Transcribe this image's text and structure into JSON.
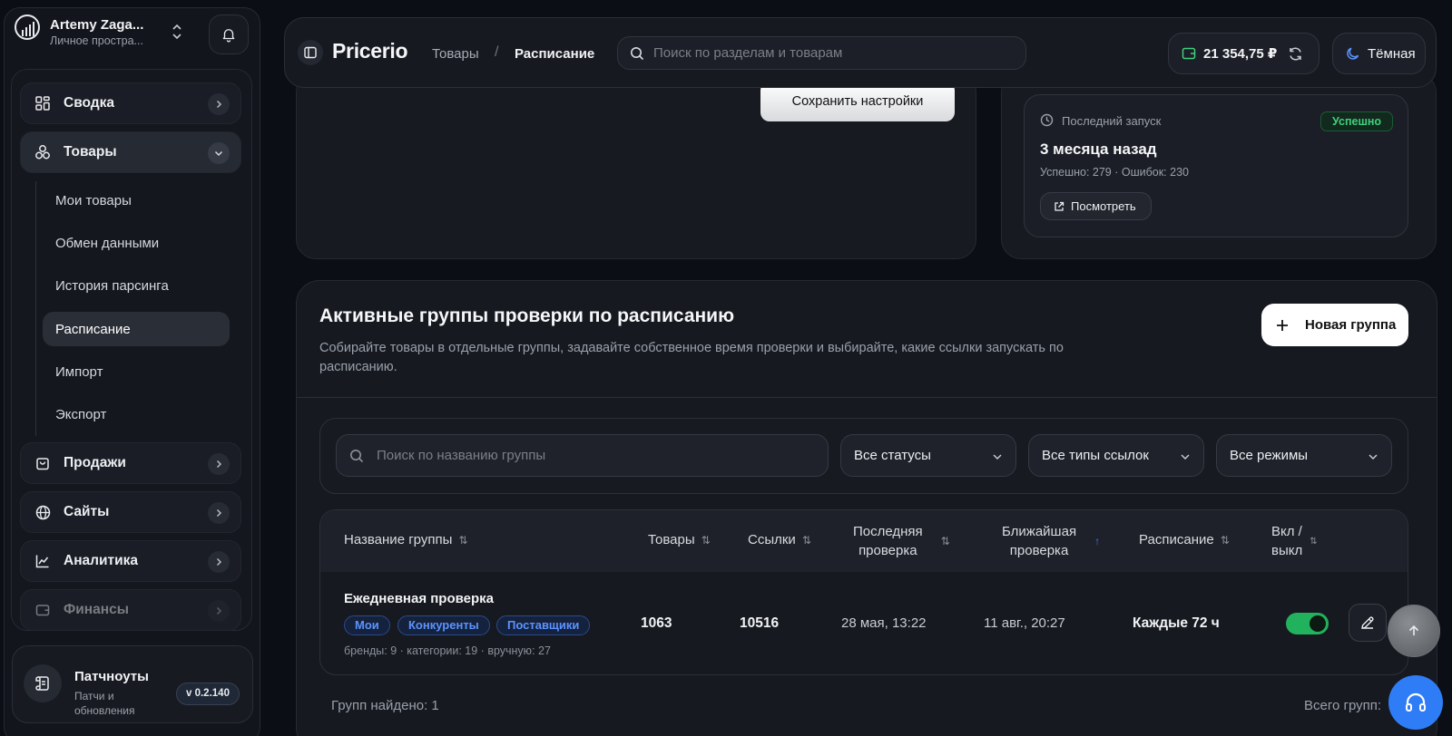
{
  "account": {
    "name": "Artemy Zaga...",
    "workspace": "Личное простра..."
  },
  "sidebar": {
    "items": [
      {
        "label": "Сводка"
      },
      {
        "label": "Товары"
      },
      {
        "label": "Продажи"
      },
      {
        "label": "Сайты"
      },
      {
        "label": "Аналитика"
      },
      {
        "label": "Финансы"
      }
    ],
    "products_submenu": [
      {
        "label": "Мои товары"
      },
      {
        "label": "Обмен данными"
      },
      {
        "label": "История парсинга"
      },
      {
        "label": "Расписание"
      },
      {
        "label": "Импорт"
      },
      {
        "label": "Экспорт"
      }
    ],
    "patchnotes": {
      "title": "Патчноуты",
      "subtitle": "Патчи и обновления",
      "version": "v 0.2.140"
    }
  },
  "header": {
    "brand": "Pricerio",
    "breadcrumb": [
      "Товары",
      "/",
      "Расписание"
    ],
    "search_placeholder": "Поиск по разделам и товарам",
    "balance": "21 354,75 ₽",
    "theme_label": "Тёмная"
  },
  "settings": {
    "save_label": "Сохранить настройки"
  },
  "last_run": {
    "label": "Последний запуск",
    "status": "Успешно",
    "when": "3 месяца назад",
    "stats": "Успешно: 279 · Ошибок: 230",
    "view_label": "Посмотреть"
  },
  "groups": {
    "title": "Активные группы проверки по расписанию",
    "description": "Собирайте товары в отдельные группы, задавайте собственное время проверки и выбирайте, какие ссылки запускать по расписанию.",
    "new_group_label": "Новая группа",
    "search_placeholder": "Поиск по названию группы",
    "filters": [
      "Все статусы",
      "Все типы ссылок",
      "Все режимы"
    ],
    "columns": {
      "name": "Название группы",
      "products": "Товары",
      "links": "Ссылки",
      "last_check_1": "Последняя",
      "last_check_2": "проверка",
      "next_check_1": "Ближайшая",
      "next_check_2": "проверка",
      "schedule": "Расписание",
      "toggle_1": "Вкл /",
      "toggle_2": "выкл"
    },
    "rows": [
      {
        "name": "Ежедневная проверка",
        "tags": [
          "Мои",
          "Конкуренты",
          "Поставщики"
        ],
        "meta": "бренды: 9 · категории: 19 · вручную: 27",
        "products": "1063",
        "links": "10516",
        "last_check": "28 мая, 13:22",
        "next_check": "11 авг., 20:27",
        "schedule": "Каждые 72 ч",
        "enabled": true
      }
    ],
    "found": "Групп найдено: 1",
    "total": "Всего групп:"
  },
  "colors": {
    "accent_blue": "#2f7df6",
    "success_green": "#22b25e",
    "tag_blue": "#5b93ff"
  }
}
